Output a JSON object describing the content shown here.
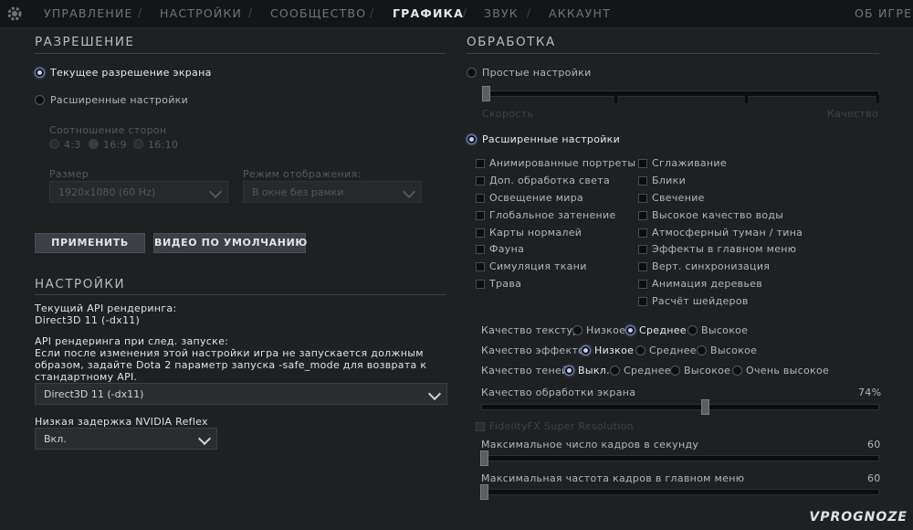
{
  "nav": {
    "items": [
      "УПРАВЛЕНИЕ",
      "НАСТРОЙКИ",
      "СООБЩЕСТВО",
      "ГРАФИКА",
      "ЗВУК",
      "АККАУНТ"
    ],
    "active": "ГРАФИКА",
    "right": "ОБ ИГРЕ",
    "gear_icon": "gear-icon"
  },
  "resolution": {
    "title": "РАЗРЕШЕНИЕ",
    "current_label": "Текущее разрешение экрана",
    "advanced_label": "Расширенные настройки",
    "aspect_label": "Соотношение сторон",
    "aspect_options": [
      "4:3",
      "16:9",
      "16:10"
    ],
    "aspect_selected": "16:9",
    "size_label": "Размер",
    "size_value": "1920x1080 (60 Hz)",
    "mode_label": "Режим отображения:",
    "mode_value": "В окне без рамки",
    "apply_button": "ПРИМЕНИТЬ",
    "default_button": "ВИДЕО ПО УМОЛЧАНИЮ"
  },
  "settings": {
    "title": "НАСТРОЙКИ",
    "current_api_label": "Текущий API рендеринга:",
    "current_api_value": "Direct3D 11 (-dx11)",
    "next_api_label": "API рендеринга при след. запуске:",
    "next_api_note_1": "Если после изменения этой настройки игра не запускается должным",
    "next_api_note_2": "образом, задайте Dota 2 параметр запуска -safe_mode для возврата к",
    "next_api_note_3": "стандартному API.",
    "api_select_value": "Direct3D 11 (-dx11)",
    "reflex_label": "Низкая задержка NVIDIA Reflex",
    "reflex_value": "Вкл."
  },
  "processing": {
    "title": "ОБРАБОТКА",
    "simple_label": "Простые настройки",
    "slider_left": "Скорость",
    "slider_right": "Качество",
    "advanced_label": "Расширенные настройки",
    "checks_left": [
      "Анимированные портреты",
      "Доп. обработка света",
      "Освещение мира",
      "Глобальное затенение",
      "Карты нормалей",
      "Фауна",
      "Симуляция ткани",
      "Трава"
    ],
    "checks_right": [
      "Сглаживание",
      "Блики",
      "Свечение",
      "Высокое качество воды",
      "Атмосферный туман / тина",
      "Эффекты в главном меню",
      "Верт. синхронизация",
      "Анимация деревьев",
      "Расчёт шейдеров"
    ],
    "texture_label": "Качество текстур",
    "texture_options": [
      "Низкое",
      "Среднее",
      "Высокое"
    ],
    "texture_selected": "Среднее",
    "effects_label": "Качество эффектов",
    "effects_options": [
      "Низкое",
      "Среднее",
      "Высокое"
    ],
    "effects_selected": "Низкое",
    "shadows_label": "Качество теней",
    "shadows_options": [
      "Выкл.",
      "Среднее",
      "Высокое",
      "Очень высокое"
    ],
    "shadows_selected": "Выкл.",
    "screen_quality_label": "Качество обработки экрана",
    "screen_quality_value": "74%",
    "screen_quality_fraction": 0.74,
    "fsr_label": "FidelityFX Super Resolution",
    "max_fps_label": "Максимальное число кадров в секунду",
    "max_fps_value": "60",
    "max_menu_fps_label": "Максимальная частота кадров в главном меню",
    "max_menu_fps_value": "60"
  },
  "watermark": "VPROGNOZE"
}
